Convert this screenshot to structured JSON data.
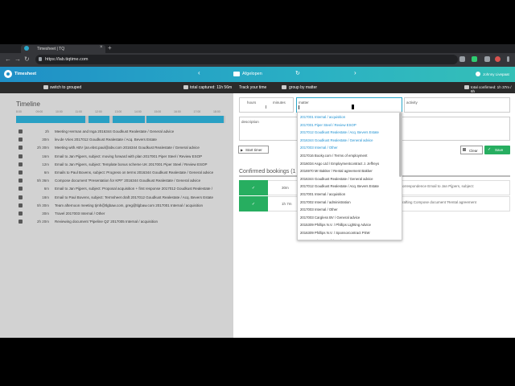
{
  "browser": {
    "tab_title": "Timesheet | TQ",
    "tab_close": "×",
    "new_tab": "+",
    "url": "https://lab.tiqtime.com",
    "back": "←",
    "forward": "→",
    "reload": "↻"
  },
  "header": {
    "app_name": "Timesheet",
    "prev": "‹",
    "next": "›",
    "date_label": "Afgelopen",
    "refresh": "↻",
    "user_name": "Johnny Livepaat",
    "brand_color": "#1f8fc7"
  },
  "toolbar": {
    "switch_label": "switch to grouped",
    "total_captured": "total captured: 11h 56m",
    "track_timer": "Track your time",
    "group_by": "group by matter",
    "total_confirmed": "total confirmed: 1h 37m / 6h"
  },
  "timeline": {
    "title": "Timeline",
    "hours": [
      "8:00",
      "09:00",
      "10:00",
      "11:00",
      "12:00",
      "13:00",
      "14:00",
      "15:00",
      "16:00",
      "17:00",
      "18:00"
    ],
    "entries": [
      {
        "icon": "calendar-icon",
        "duration": "2h",
        "desc": "Meeting Herman and Inga  2016344 Goudkust Realestate / General advice"
      },
      {
        "icon": "document-icon",
        "duration": "30m",
        "desc": "lev.de Vries  2017012 Goudkust Realestate / Acq. Bevers Estate"
      },
      {
        "icon": "calendar-icon",
        "duration": "2h 30m",
        "desc": "Meeting with ABV (an.ebst.paul@abv.com  2016344 Goudkust Realestate / General advice"
      },
      {
        "icon": "mail-icon",
        "duration": "16m",
        "desc": "Email to Jan Pijpers, subject: moving forward with plan  2017001 Piper Steel / Review ESOP"
      },
      {
        "icon": "mail-icon",
        "duration": "12m",
        "desc": "Email to Jan Pijpers, subject: Template bonus scheme UK  2017001 Piper Steel / Review ESOP"
      },
      {
        "icon": "mail-icon",
        "duration": "6m",
        "desc": "Emails to Paul Bovens, subject: Progress on terms  2016344 Goudkust Realestate / General advice"
      },
      {
        "icon": "document-icon",
        "duration": "5h 36m",
        "desc": "Compose document 'Presentation for KPF'  2016344 Goudkust Realestate / General advice"
      },
      {
        "icon": "mail-icon",
        "duration": "6m",
        "desc": "Email to Jan Pijpers, subject: Proposal acquisition + first response  2017012 Goudkust Realestate /"
      },
      {
        "icon": "mail-icon",
        "duration": "18m",
        "desc": "Email to Paul Bovens, subject: Termsheet draft  2017012 Goudkust Realestate / Acq. Bevers Estate"
      },
      {
        "icon": "calendar-icon",
        "duration": "5h 30m",
        "desc": "Team afternoon meeting tjmh@tlgbaw.com, greg@tlgbaw.com  2017001 Internal / acquisition"
      },
      {
        "icon": "calendar-icon",
        "duration": "30m",
        "desc": "Travel  2017003 Internal / Other"
      },
      {
        "icon": "document-icon",
        "duration": "2h 20m",
        "desc": "Reviewing document 'Pipeline Q2'  2017005 Internal / acquisition"
      }
    ]
  },
  "form": {
    "hours_label": "hours",
    "minutes_label": "minutes",
    "matter_label": "matter",
    "activity_label": "activity",
    "description_placeholder": "description",
    "start_timer": "Start timer",
    "clear": "Clear",
    "save": "Save"
  },
  "dropdown": {
    "recent": [
      "2017001 Internal / acquisition",
      "2017001 Piper Steel / Review ESOP",
      "2017012 Goudkust Realestate / Acq. Bevers Estate",
      "2016344 Goudkust Realestate / General advice",
      "2017003 Internal / Other"
    ],
    "all": [
      "2017016 Booky.com / Terms of employment",
      "2016034 Asgo Ltd / Employmentcontract J. Jeffreys",
      "2016970 Mr Bakker / Rental agreement Bakker",
      "2016344 Goudkust Realestate / General advice",
      "2017012 Goudkust Realestate / Acq. Bevers Estate",
      "2017001 Internal / acquisition",
      "2017002 Internal / administration",
      "2017003 Internal / Other",
      "2017003 Cargless BV / General advice",
      "2015309 Phillips N.V. / Phillips Lighting Advice",
      "2016309 Phillips N.V. / Sponsorcontract PSW",
      "2017001 Piper Steel / Review ESOP"
    ]
  },
  "confirmed": {
    "title": "Confirmed bookings (1",
    "rows": [
      {
        "duration": "30m",
        "text": "orrespondence  Email to Jan Pijpers, subject:"
      },
      {
        "duration": "1h 7m",
        "text": "rafting  Compose document 'Rental agreement"
      }
    ]
  }
}
